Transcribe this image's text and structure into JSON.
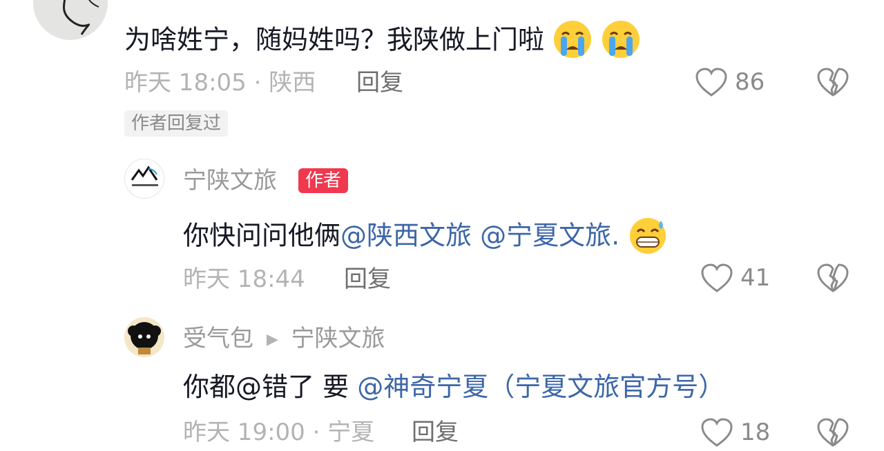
{
  "comment1": {
    "text": "为啥姓宁，随妈姓吗？我陕做上门啦",
    "emojis": [
      "crying-face",
      "crying-face"
    ],
    "time": "昨天 18:05 · 陕西",
    "reply_label": "回复",
    "likes": "86",
    "author_replied_tag": "作者回复过"
  },
  "reply1": {
    "username": "宁陕文旅",
    "badge": "作者",
    "text_prefix": "你快问问他俩",
    "mention1": "@陕西文旅",
    "mention2": "@宁夏文旅.",
    "emoji": "grinning-sweat-face",
    "time": "昨天 18:44",
    "reply_label": "回复",
    "likes": "41"
  },
  "reply2": {
    "username": "受气包",
    "reply_to": "宁陕文旅",
    "text_prefix": "你都@错了 要",
    "mention": "@神奇宁夏（宁夏文旅官方号）",
    "time": "昨天 19:00 · 宁夏",
    "reply_label": "回复",
    "likes": "18"
  },
  "colors": {
    "mention": "#3c66a8",
    "author_badge": "#f0384f",
    "meta_text": "#b3b3b3"
  }
}
